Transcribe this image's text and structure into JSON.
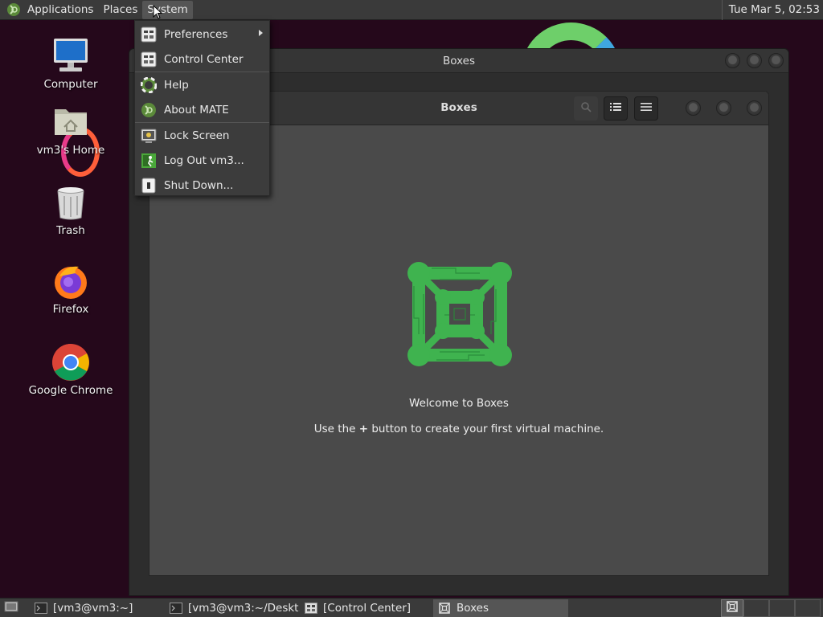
{
  "top_panel": {
    "menus": [
      "Applications",
      "Places",
      "System"
    ],
    "clock": "Tue Mar  5, 02:53"
  },
  "desktop": {
    "icons": [
      {
        "label": "Computer",
        "icon": "computer-icon"
      },
      {
        "label": "vm3's Home",
        "icon": "home-folder-icon"
      },
      {
        "label": "Trash",
        "icon": "trash-icon"
      },
      {
        "label": "Firefox",
        "icon": "firefox-icon"
      },
      {
        "label": "Google Chrome",
        "icon": "chrome-icon"
      }
    ]
  },
  "windows": {
    "back_title": "Boxes",
    "front_title": "Boxes",
    "welcome_title": "Welcome to Boxes",
    "welcome_pre": "Use the ",
    "welcome_plus": "+",
    "welcome_post": " button to create your first virtual machine."
  },
  "system_menu": {
    "items": [
      {
        "label": "Preferences",
        "icon": "preferences-icon",
        "submenu": true
      },
      {
        "label": "Control Center",
        "icon": "control-center-icon"
      },
      {
        "label": "Help",
        "icon": "help-icon"
      },
      {
        "label": "About MATE",
        "icon": "mate-logo-icon"
      },
      {
        "label": "Lock Screen",
        "icon": "lock-screen-icon"
      },
      {
        "label": "Log Out vm3...",
        "icon": "log-out-icon"
      },
      {
        "label": "Shut Down...",
        "icon": "shut-down-icon"
      }
    ]
  },
  "taskbar": {
    "tasks": [
      {
        "label": "[vm3@vm3:~]",
        "icon": "terminal-icon"
      },
      {
        "label": "[vm3@vm3:~/Deskt...",
        "icon": "terminal-icon"
      },
      {
        "label": "[Control Center]",
        "icon": "control-center-icon"
      },
      {
        "label": "Boxes",
        "icon": "boxes-icon",
        "active": true
      }
    ]
  },
  "colors": {
    "accent_green": "#3fb34f",
    "panel": "#3a3a3a",
    "window_bg": "#4a4a4a"
  }
}
